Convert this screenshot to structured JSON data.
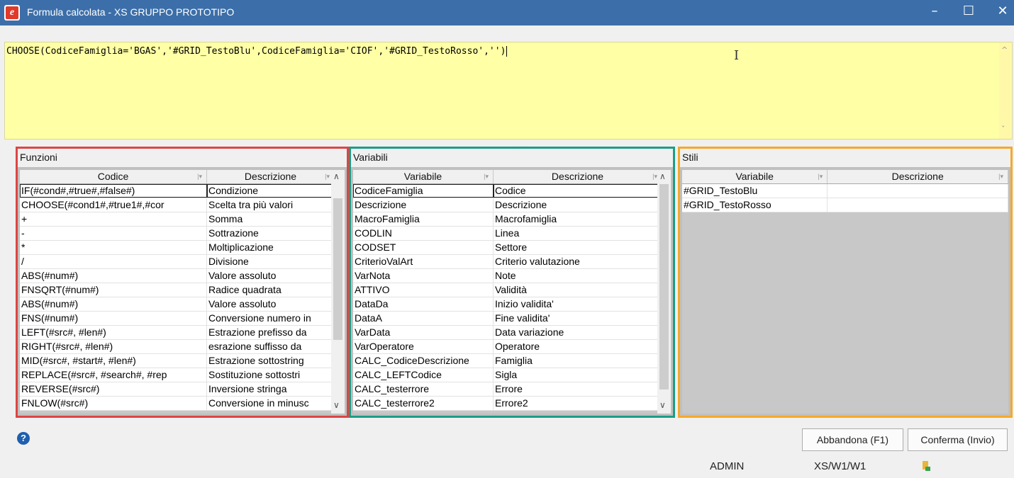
{
  "window": {
    "title": "Formula calcolata - XS  GRUPPO PROTOTIPO",
    "icon": "app-logo-icon",
    "controls": [
      "minimize-icon",
      "maximize-icon",
      "close-icon"
    ]
  },
  "editor": {
    "formula": "CHOOSE(CodiceFamiglia='BGAS','#GRID_TestoBlu',CodiceFamiglia='CIOF','#GRID_TestoRosso','')",
    "background": "#ffffa6",
    "splitter": "......"
  },
  "functions": {
    "title": "Funzioni",
    "border_color": "#dc4545",
    "columns": [
      "Codice",
      "Descrizione"
    ],
    "rows": [
      [
        "IF(#cond#,#true#,#false#)",
        "Condizione"
      ],
      [
        "CHOOSE(#cond1#,#true1#,#cor",
        "Scelta tra più valori"
      ],
      [
        "+",
        "Somma"
      ],
      [
        "-",
        "Sottrazione"
      ],
      [
        "*",
        "Moltiplicazione"
      ],
      [
        "/",
        "Divisione"
      ],
      [
        "ABS(#num#)",
        "Valore assoluto"
      ],
      [
        "FNSQRT(#num#)",
        "Radice quadrata"
      ],
      [
        "ABS(#num#)",
        "Valore assoluto"
      ],
      [
        "FNS(#num#)",
        "Conversione numero in"
      ],
      [
        "LEFT(#src#, #len#)",
        "Estrazione prefisso da"
      ],
      [
        "RIGHT(#src#, #len#)",
        "esrazione suffisso da"
      ],
      [
        "MID(#src#, #start#, #len#)",
        "Estrazione sottostring"
      ],
      [
        "REPLACE(#src#, #search#, #rep",
        "Sostituzione sottostri"
      ],
      [
        "REVERSE(#src#)",
        "Inversione stringa"
      ],
      [
        "FNLOW(#src#)",
        "Conversione in minusc"
      ]
    ]
  },
  "variables": {
    "title": "Variabili",
    "border_color": "#1a9e86",
    "columns": [
      "Variabile",
      "Descrizione"
    ],
    "rows": [
      [
        "CodiceFamiglia",
        "Codice"
      ],
      [
        "Descrizione",
        "Descrizione"
      ],
      [
        "MacroFamiglia",
        "Macrofamiglia"
      ],
      [
        "CODLIN",
        "Linea"
      ],
      [
        "CODSET",
        "Settore"
      ],
      [
        "CriterioValArt",
        "Criterio valutazione"
      ],
      [
        "VarNota",
        "Note"
      ],
      [
        "ATTIVO",
        "Validità"
      ],
      [
        "DataDa",
        "Inizio validita'"
      ],
      [
        "DataA",
        "Fine validita'"
      ],
      [
        "VarData",
        "Data variazione"
      ],
      [
        "VarOperatore",
        "Operatore"
      ],
      [
        "CALC_CodiceDescrizione",
        "Famiglia"
      ],
      [
        "CALC_LEFTCodice",
        "Sigla"
      ],
      [
        "CALC_testerrore",
        "Errore"
      ],
      [
        "CALC_testerrore2",
        "Errore2"
      ]
    ]
  },
  "styles": {
    "title": "Stili",
    "border_color": "#f4a92b",
    "columns": [
      "Variabile",
      "Descrizione"
    ],
    "rows": [
      [
        "#GRID_TestoBlu",
        ""
      ],
      [
        "#GRID_TestoRosso",
        ""
      ]
    ]
  },
  "footer": {
    "help_icon": "help-question-icon",
    "cancel_label": "Abbandona (F1)",
    "confirm_label": "Conferma (Invio)"
  },
  "status": {
    "user": "ADMIN",
    "path": "XS/W1/W1",
    "icon": "database-status-icon"
  }
}
